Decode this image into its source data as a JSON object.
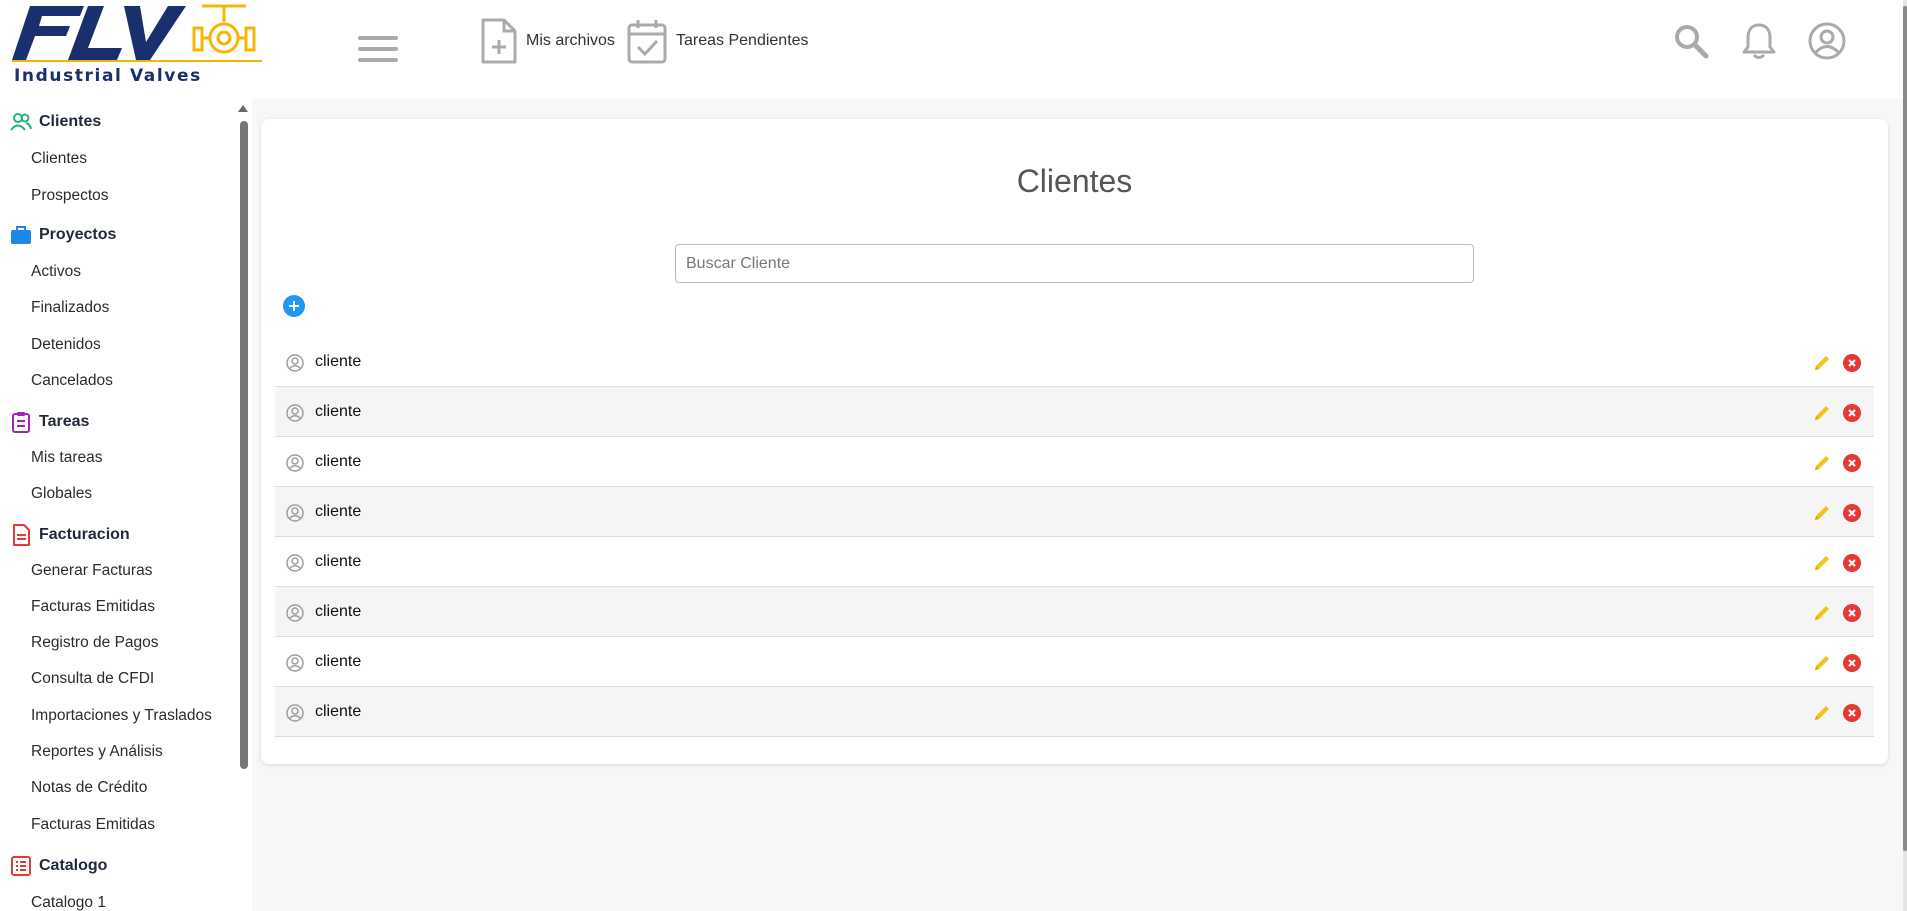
{
  "brand": {
    "logo_text": "Industrial Valves",
    "logo_letters": "FLV",
    "navy": "#1a2f6e",
    "gold": "#f2b705"
  },
  "topbar": {
    "links": [
      {
        "label": "Mis archivos",
        "icon": "file-plus-icon"
      },
      {
        "label": "Tareas Pendientes",
        "icon": "calendar-check-icon"
      }
    ],
    "icons": [
      "search-icon",
      "bell-icon",
      "user-circle-icon"
    ]
  },
  "sidebar": {
    "sections": [
      {
        "title": "Clientes",
        "icon": "users-icon",
        "color": "#22b573",
        "items": [
          "Clientes",
          "Prospectos"
        ]
      },
      {
        "title": "Proyectos",
        "icon": "briefcase-icon",
        "color": "#1e88e5",
        "items": [
          "Activos",
          "Finalizados",
          "Detenidos",
          "Cancelados"
        ]
      },
      {
        "title": "Tareas",
        "icon": "clipboard-icon",
        "color": "#9c27b0",
        "items": [
          "Mis tareas",
          "Globales"
        ]
      },
      {
        "title": "Facturacion",
        "icon": "document-icon",
        "color": "#e53935",
        "items": [
          "Generar Facturas",
          "Facturas Emitidas",
          "Registro de Pagos",
          "Consulta de CFDI",
          "Importaciones y Traslados",
          "Reportes y Análisis",
          "Notas de Crédito",
          "Facturas Emitidas"
        ]
      },
      {
        "title": "Catalogo",
        "icon": "list-icon",
        "color": "#e53935",
        "items": [
          "Catalogo 1"
        ]
      }
    ]
  },
  "main": {
    "title": "Clientes",
    "search_placeholder": "Buscar Cliente",
    "search_value": "",
    "rows": [
      "cliente",
      "cliente",
      "cliente",
      "cliente",
      "cliente",
      "cliente",
      "cliente",
      "cliente"
    ],
    "accent_add": "#2196f3",
    "accent_edit": "#f0c419",
    "accent_delete": "#e53935"
  }
}
